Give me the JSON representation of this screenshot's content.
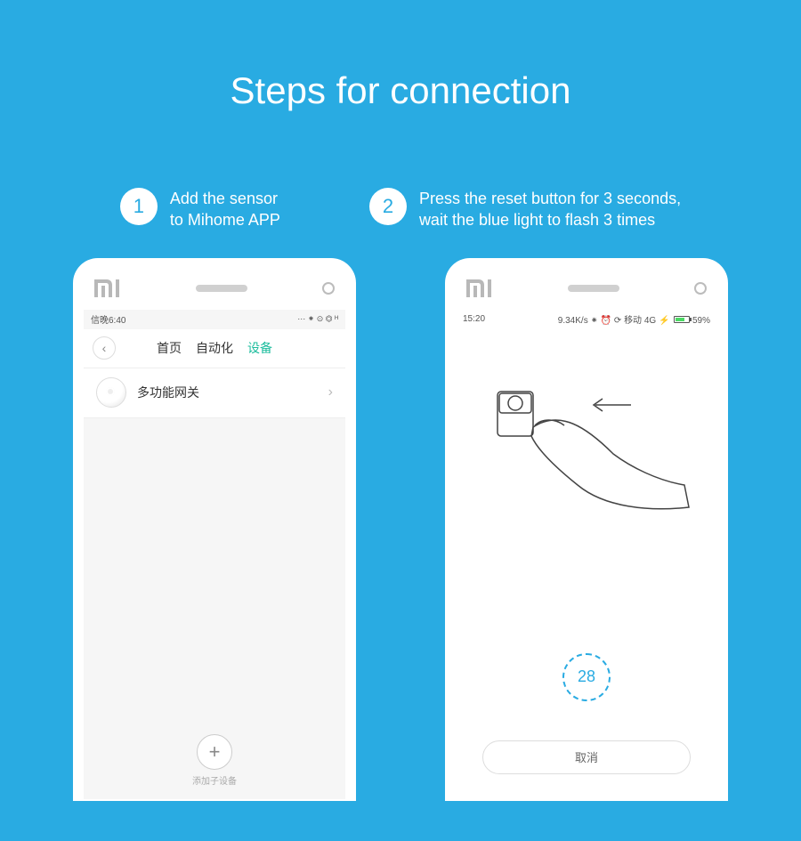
{
  "title": "Steps for connection",
  "steps": [
    {
      "num": "1",
      "text": "Add the sensor\nto Mihome APP"
    },
    {
      "num": "2",
      "text": "Press the reset button for 3 seconds,\nwait the blue light to flash 3 times"
    }
  ],
  "phone1": {
    "status_time": "信晚6:40",
    "status_right": "⋯ ⁕ ⊙ ⏣ ᴴ",
    "tabs": {
      "home": "首页",
      "automation": "自动化",
      "devices": "设备"
    },
    "device_name": "多功能网关",
    "add_label": "添加子设备"
  },
  "phone2": {
    "status_time": "15:20",
    "status_speed": "9.34K/s",
    "status_net": "移动 4G",
    "status_batt": "59%",
    "countdown": "28",
    "cancel": "取消"
  }
}
